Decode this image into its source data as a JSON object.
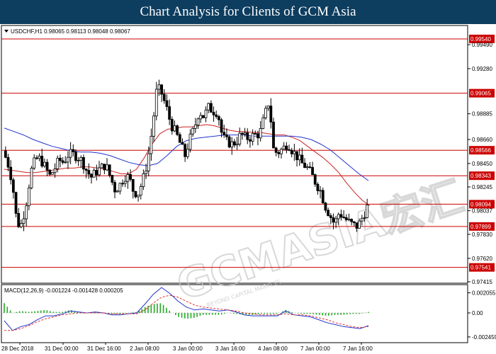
{
  "banner": {
    "title": "Chart Analysis for Clients of GCM Asia"
  },
  "watermark": {
    "main": "GCMASIA宏汇",
    "sub": "BEYOND CAPITAL MARKETS"
  },
  "colors": {
    "banner_bg": "#0d3d5f",
    "level_line": "#cc0000",
    "level_tag": "#cc0000",
    "ma_red": "#cc2222",
    "ma_blue": "#2233cc",
    "macd_line": "#2233cc",
    "signal_line": "#dd3333",
    "histogram": "#22aa22",
    "candle_up": "#ffffff",
    "candle_down": "#000000"
  },
  "symbol_header": {
    "text": "USDCHF,H1  0.98065 0.98113 0.98048 0.98067",
    "marker": "triangle-down-icon"
  },
  "macd_header": {
    "text": "MACD(12,26,9) -0.001224 -0.001428 0.000205"
  },
  "chart_data": [
    {
      "type": "candlestick",
      "symbol": "USDCHF",
      "timeframe": "H1",
      "last": {
        "open": 0.98065,
        "high": 0.98113,
        "low": 0.98048,
        "close": 0.98067
      },
      "ylim": [
        0.97415,
        0.99645
      ],
      "y_ticks": [
        "0.99490",
        "0.99280",
        "0.98885",
        "0.98660",
        "0.98450",
        "0.98245",
        "0.98037",
        "0.97830",
        "0.97620",
        "0.97415"
      ],
      "x_ticks": [
        "28 Dec 2018",
        "31 Dec 00:00",
        "31 Dec 16:00",
        "2 Jan 08:00",
        "3 Jan 00:00",
        "3 Jan 16:00",
        "4 Jan 08:00",
        "7 Jan 00:00",
        "7 Jan 16:00"
      ],
      "levels": [
        {
          "label": "0.99540",
          "value": 0.9954
        },
        {
          "label": "0.99065",
          "value": 0.99065
        },
        {
          "label": "0.98566",
          "value": 0.98566
        },
        {
          "label": "0.98343",
          "value": 0.98343
        },
        {
          "label": "0.98094",
          "value": 0.98094
        },
        {
          "label": "0.97899",
          "value": 0.97899
        },
        {
          "label": "0.97541",
          "value": 0.97541
        }
      ],
      "price_path": [
        0.9856,
        0.9846,
        0.9829,
        0.9792,
        0.9792,
        0.9811,
        0.9838,
        0.9849,
        0.9849,
        0.9842,
        0.9834,
        0.984,
        0.9848,
        0.9846,
        0.9853,
        0.9853,
        0.9851,
        0.9847,
        0.9838,
        0.9833,
        0.9838,
        0.9841,
        0.9844,
        0.9833,
        0.9822,
        0.9826,
        0.9834,
        0.9833,
        0.982,
        0.9819,
        0.9831,
        0.9848,
        0.9876,
        0.9912,
        0.9906,
        0.9894,
        0.9879,
        0.9872,
        0.9862,
        0.9852,
        0.9866,
        0.9876,
        0.9891,
        0.9886,
        0.9894,
        0.9891,
        0.989,
        0.9868,
        0.9864,
        0.9862,
        0.9864,
        0.9871,
        0.9867,
        0.9868,
        0.987,
        0.9871,
        0.9886,
        0.99,
        0.9855,
        0.9855,
        0.9858,
        0.9863,
        0.9856,
        0.9851,
        0.9845,
        0.9842,
        0.9836,
        0.9828,
        0.9821,
        0.9808,
        0.98,
        0.9792,
        0.9802,
        0.9798,
        0.9794,
        0.9791,
        0.979,
        0.9798,
        0.9807
      ],
      "ma_red": [
        0.984,
        0.9839,
        0.9838,
        0.9837,
        0.9837,
        0.9838,
        0.9839,
        0.984,
        0.9841,
        0.9841,
        0.9842,
        0.9842,
        0.9841,
        0.984,
        0.9838,
        0.9836,
        0.9836,
        0.984,
        0.985,
        0.9862,
        0.9871,
        0.9875,
        0.9876,
        0.9877,
        0.9877,
        0.9878,
        0.9879,
        0.9878,
        0.9876,
        0.9874,
        0.9873,
        0.9873,
        0.9872,
        0.9872,
        0.9871,
        0.987,
        0.987,
        0.9868,
        0.9865,
        0.986,
        0.9855,
        0.985,
        0.9844,
        0.9837,
        0.9828,
        0.982,
        0.9813,
        0.9808
      ],
      "ma_blue": [
        0.9876,
        0.9873,
        0.987,
        0.9866,
        0.9863,
        0.986,
        0.9858,
        0.9856,
        0.9855,
        0.9855,
        0.9854,
        0.9852,
        0.9849,
        0.9846,
        0.9844,
        0.9843,
        0.9845,
        0.9852,
        0.986,
        0.9865,
        0.9867,
        0.9868,
        0.9869,
        0.987,
        0.987,
        0.987,
        0.9869,
        0.9869,
        0.9869,
        0.9869,
        0.9869,
        0.9868,
        0.9866,
        0.9862,
        0.9857,
        0.985,
        0.9843,
        0.9836,
        0.983
      ],
      "series": [
        {
          "name": "USDCHF,H1"
        }
      ]
    },
    {
      "type": "line",
      "indicator": "MACD(12,26,9)",
      "values_header": {
        "main": -0.001224,
        "signal": -0.001428,
        "histogram": 0.000205
      },
      "ylim": [
        -0.0029,
        0.00275
      ],
      "y_ticks": [
        "0.002055",
        "0.00",
        "-0.002459"
      ],
      "macd": [
        -0.0008,
        -0.0018,
        -0.0014,
        -0.0012,
        -0.0007,
        -0.0003,
        -0.0003,
        -0.0001,
        0.0002,
        0.0001,
        0.0,
        0.0001,
        0.0,
        -0.0002,
        -0.0002,
        -0.0001,
        0.0,
        0.0009,
        0.0019,
        0.0026,
        0.002,
        0.0012,
        0.0006,
        0.0003,
        0.0004,
        0.0003,
        0.0002,
        0.0003,
        0.0001,
        -0.0002,
        -0.0003,
        -0.0003,
        -0.0003,
        -0.0003,
        0.0002,
        -0.0002,
        -0.0003,
        -0.0004,
        -0.0007,
        -0.001,
        -0.0012,
        -0.0014,
        -0.0015,
        -0.0016,
        -0.0013
      ],
      "signal": [
        -0.0018,
        -0.0018,
        -0.0016,
        -0.0013,
        -0.0009,
        -0.0006,
        -0.0004,
        -0.0002,
        -0.0001,
        0.0,
        0.0,
        0.0,
        0.0,
        -0.0001,
        -0.0001,
        -0.0001,
        -0.0001,
        0.0003,
        0.001,
        0.0016,
        0.0018,
        0.0016,
        0.0012,
        0.0008,
        0.0006,
        0.0005,
        0.0004,
        0.0003,
        0.0002,
        0.0,
        -0.0001,
        -0.0002,
        -0.0002,
        -0.0002,
        -0.0001,
        -0.0002,
        -0.0002,
        -0.0003,
        -0.0005,
        -0.0007,
        -0.001,
        -0.0012,
        -0.0014,
        -0.0015,
        -0.0014
      ],
      "histogram": [
        0.001,
        0.0,
        0.0002,
        0.0001,
        0.0002,
        0.0003,
        0.0001,
        0.0001,
        0.0003,
        0.0001,
        0.0,
        0.0001,
        0.0,
        -0.0001,
        -0.0001,
        0.0,
        0.0001,
        0.0006,
        0.0009,
        0.001,
        0.0002,
        -0.0004,
        -0.0006,
        -0.0005,
        -0.0002,
        -0.0002,
        -0.0002,
        0.0,
        -0.0001,
        -0.0002,
        -0.0002,
        -0.0001,
        -0.0001,
        -0.0001,
        0.0003,
        0.0,
        -0.0001,
        -0.0001,
        -0.0002,
        -0.0003,
        -0.0002,
        -0.0002,
        -0.0001,
        -0.0001,
        0.0001
      ]
    }
  ]
}
